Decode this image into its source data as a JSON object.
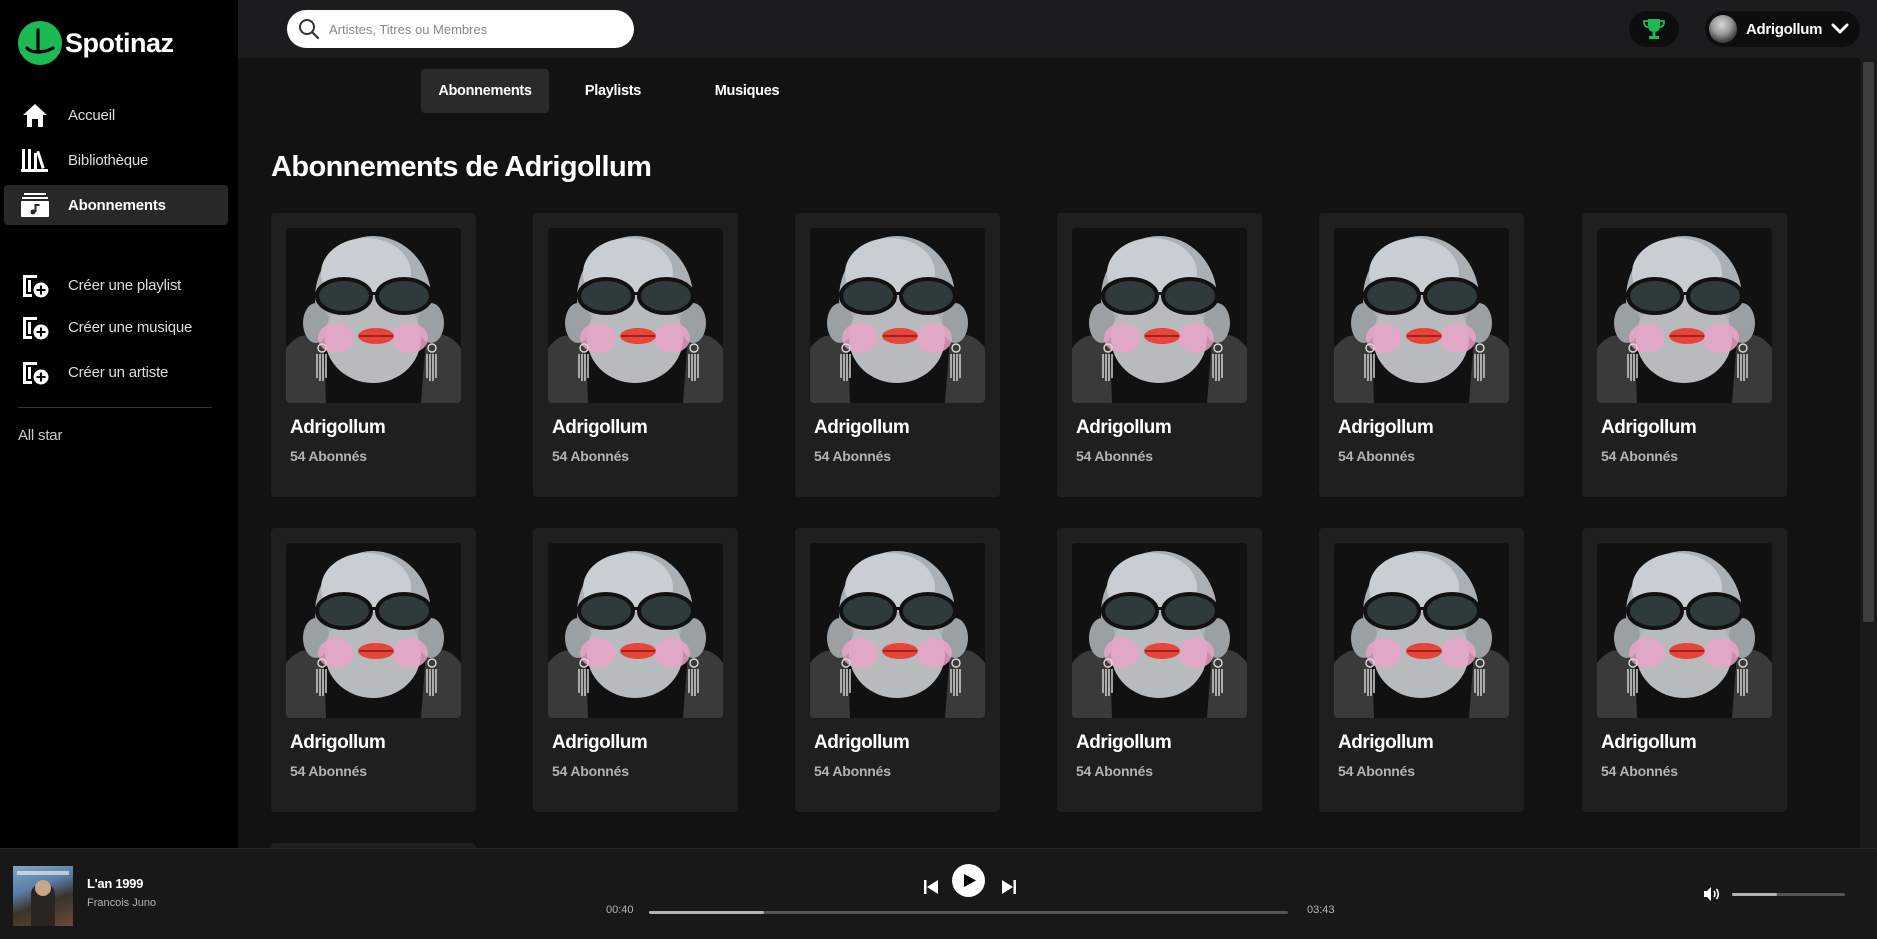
{
  "app": {
    "name": "Spotinaz",
    "accent": "#1db954"
  },
  "sidebar": {
    "items": [
      {
        "label": "Accueil",
        "icon": "home-icon",
        "active": false
      },
      {
        "label": "Bibliothèque",
        "icon": "library-icon",
        "active": false
      },
      {
        "label": "Abonnements",
        "icon": "subscriptions-icon",
        "active": true
      }
    ],
    "create_items": [
      {
        "label": "Créer une playlist",
        "icon": "add-playlist-icon"
      },
      {
        "label": "Créer une musique",
        "icon": "add-music-icon"
      },
      {
        "label": "Créer un artiste",
        "icon": "add-artist-icon"
      }
    ],
    "extra": "All star"
  },
  "topbar": {
    "search_placeholder": "Artistes, Titres ou Membres",
    "trophy_icon": "trophy-icon",
    "user": {
      "name": "Adrigollum"
    }
  },
  "tabs": [
    {
      "label": "Abonnements",
      "active": true
    },
    {
      "label": "Playlists",
      "active": false
    },
    {
      "label": "Musiques",
      "active": false
    }
  ],
  "page_title": "Abonnements de Adrigollum",
  "cards": [
    {
      "name": "Adrigollum",
      "subtitle": "54 Abonnés"
    },
    {
      "name": "Adrigollum",
      "subtitle": "54 Abonnés"
    },
    {
      "name": "Adrigollum",
      "subtitle": "54 Abonnés"
    },
    {
      "name": "Adrigollum",
      "subtitle": "54 Abonnés"
    },
    {
      "name": "Adrigollum",
      "subtitle": "54 Abonnés"
    },
    {
      "name": "Adrigollum",
      "subtitle": "54 Abonnés"
    },
    {
      "name": "Adrigollum",
      "subtitle": "54 Abonnés"
    },
    {
      "name": "Adrigollum",
      "subtitle": "54 Abonnés"
    },
    {
      "name": "Adrigollum",
      "subtitle": "54 Abonnés"
    },
    {
      "name": "Adrigollum",
      "subtitle": "54 Abonnés"
    },
    {
      "name": "Adrigollum",
      "subtitle": "54 Abonnés"
    },
    {
      "name": "Adrigollum",
      "subtitle": "54 Abonnés"
    }
  ],
  "player": {
    "title": "L'an 1999",
    "artist": "Francois Juno",
    "elapsed": "00:40",
    "duration": "03:43",
    "progress": 0.18,
    "volume": 0.4
  }
}
